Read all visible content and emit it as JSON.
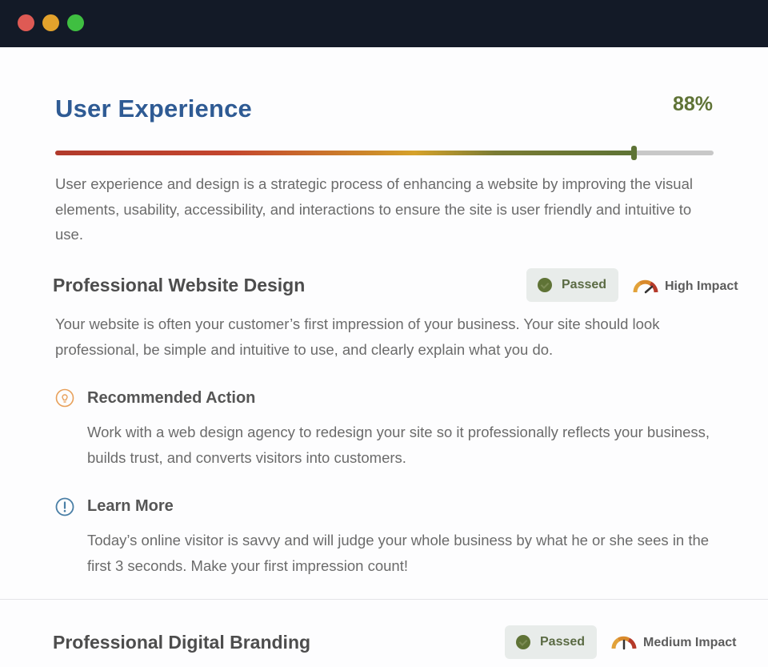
{
  "window": {
    "controls": [
      "close",
      "minimize",
      "maximize"
    ]
  },
  "section": {
    "title": "User Experience",
    "score_text": "88%",
    "score_fraction": 0.88,
    "description": "User experience and design is a strategic process of enhancing a website by improving the visual elements, usability, accessibility, and interactions to ensure the site is user friendly and intuitive to use."
  },
  "checks": [
    {
      "title": "Professional Website Design",
      "status": "Passed",
      "impact": "High Impact",
      "impact_level": "high",
      "description": "Your website is often your customer’s first impression of your business. Your site should look professional, be simple and intuitive to use, and clearly explain what you do.",
      "recommended_action": {
        "heading": "Recommended Action",
        "icon": "lightbulb-icon",
        "text": "Work with a web design agency to redesign your site so it professionally reflects your business, builds trust, and converts visitors into customers."
      },
      "learn_more": {
        "heading": "Learn More",
        "icon": "info-icon",
        "text": "Today’s online visitor is savvy and will judge your whole business by what he or she sees in the first 3 seconds. Make your first impression count!"
      }
    },
    {
      "title": "Professional Digital Branding",
      "status": "Passed",
      "impact": "Medium Impact",
      "impact_level": "medium"
    }
  ],
  "colors": {
    "title_blue": "#2f5b94",
    "score_green": "#5f7336",
    "titlebar": "#131a27",
    "lightbulb_orange": "#e8a05a",
    "info_blue": "#4a7fa6"
  }
}
